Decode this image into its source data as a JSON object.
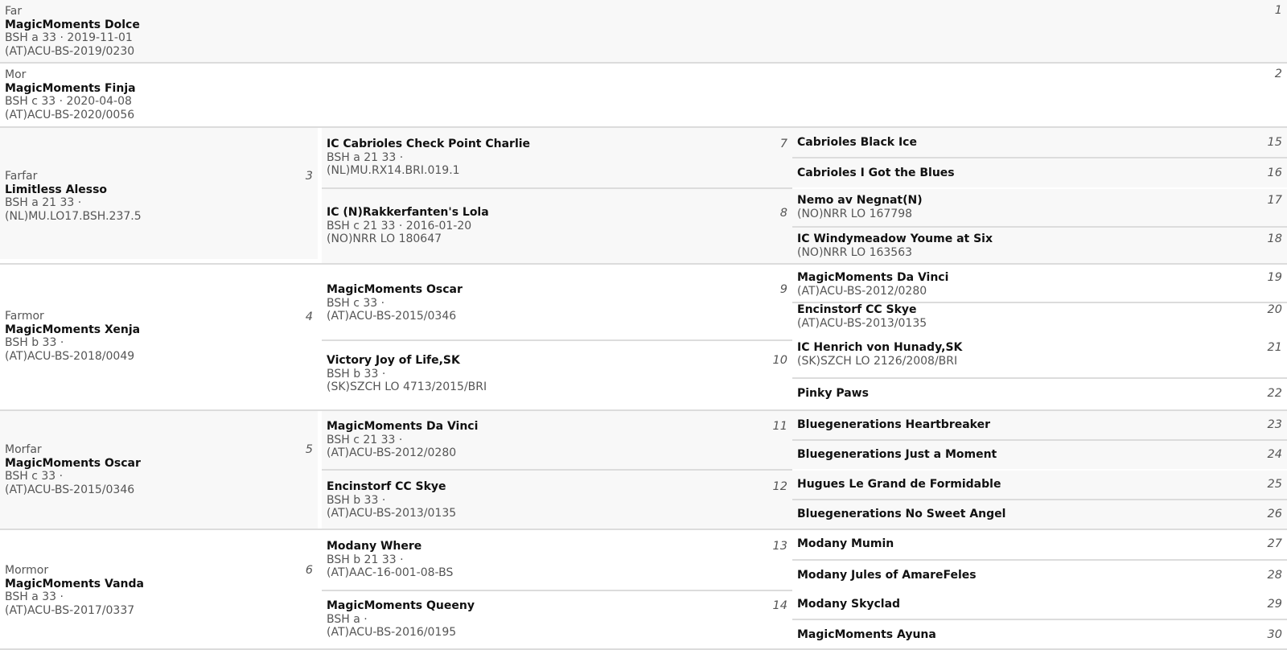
{
  "parents": [
    {
      "role": "Far",
      "name": "MagicMoments Dolce",
      "info": "BSH a 33 · 2019-11-01",
      "reg": "(AT)ACU-BS-2019/0230",
      "num": "1"
    },
    {
      "role": "Mor",
      "name": "MagicMoments Finja",
      "info": "BSH c 33 · 2020-04-08",
      "reg": "(AT)ACU-BS-2020/0056",
      "num": "2"
    }
  ],
  "grandparents": [
    {
      "role": "Farfar",
      "name": "Limitless Alesso",
      "info": "BSH a 21 33 ·",
      "reg": "(NL)MU.LO17.BSH.237.5",
      "num": "3"
    },
    {
      "role": "Farmor",
      "name": "MagicMoments Xenja",
      "info": "BSH b 33 ·",
      "reg": "(AT)ACU-BS-2018/0049",
      "num": "4"
    },
    {
      "role": "Morfar",
      "name": "MagicMoments Oscar",
      "info": "BSH c 33 ·",
      "reg": "(AT)ACU-BS-2015/0346",
      "num": "5"
    },
    {
      "role": "Mormor",
      "name": "MagicMoments Vanda",
      "info": "BSH a 33 ·",
      "reg": "(AT)ACU-BS-2017/0337",
      "num": "6"
    }
  ],
  "great_grandparents": [
    {
      "name": "IC Cabrioles Check Point Charlie",
      "info": "BSH a 21 33 ·",
      "reg": "(NL)MU.RX14.BRI.019.1",
      "num": "7"
    },
    {
      "name": "IC (N)Rakkerfanten's Lola",
      "info": "BSH c 21 33 · 2016-01-20",
      "reg": "(NO)NRR LO 180647",
      "num": "8"
    },
    {
      "name": "MagicMoments Oscar",
      "info": "BSH c 33 ·",
      "reg": "(AT)ACU-BS-2015/0346",
      "num": "9"
    },
    {
      "name": "Victory Joy of Life,SK",
      "info": "BSH b 33 ·",
      "reg": "(SK)SZCH LO 4713/2015/BRI",
      "num": "10"
    },
    {
      "name": "MagicMoments Da Vinci",
      "info": "BSH c 21 33 ·",
      "reg": "(AT)ACU-BS-2012/0280",
      "num": "11"
    },
    {
      "name": "Encinstorf CC Skye",
      "info": "BSH b 33 ·",
      "reg": "(AT)ACU-BS-2013/0135",
      "num": "12"
    },
    {
      "name": "Modany Where",
      "info": "BSH b 21 33 ·",
      "reg": "(AT)AAC-16-001-08-BS",
      "num": "13"
    },
    {
      "name": "MagicMoments Queeny",
      "info": "BSH a ·",
      "reg": "(AT)ACU-BS-2016/0195",
      "num": "14"
    }
  ],
  "great_great_grandparents": [
    {
      "name": "Cabrioles Black Ice",
      "reg": "",
      "num": "15"
    },
    {
      "name": "Cabrioles I Got the Blues",
      "reg": "",
      "num": "16"
    },
    {
      "name": "Nemo av Negnat(N)",
      "reg": "(NO)NRR LO 167798",
      "num": "17"
    },
    {
      "name": "IC Windymeadow Youme at Six",
      "reg": "(NO)NRR LO 163563",
      "num": "18"
    },
    {
      "name": "MagicMoments Da Vinci",
      "reg": "(AT)ACU-BS-2012/0280",
      "num": "19"
    },
    {
      "name": "Encinstorf CC Skye",
      "reg": "(AT)ACU-BS-2013/0135",
      "num": "20"
    },
    {
      "name": "IC Henrich von Hunady,SK",
      "reg": "(SK)SZCH LO 2126/2008/BRI",
      "num": "21"
    },
    {
      "name": "Pinky Paws",
      "reg": "",
      "num": "22"
    },
    {
      "name": "Bluegenerations Heartbreaker",
      "reg": "",
      "num": "23"
    },
    {
      "name": "Bluegenerations Just a Moment",
      "reg": "",
      "num": "24"
    },
    {
      "name": "Hugues Le Grand de Formidable",
      "reg": "",
      "num": "25"
    },
    {
      "name": "Bluegenerations No Sweet Angel",
      "reg": "",
      "num": "26"
    },
    {
      "name": "Modany Mumin",
      "reg": "",
      "num": "27"
    },
    {
      "name": "Modany Jules of AmareFeles",
      "reg": "",
      "num": "28"
    },
    {
      "name": "Modany Skyclad",
      "reg": "",
      "num": "29"
    },
    {
      "name": "MagicMoments Ayuna",
      "reg": "",
      "num": "30"
    }
  ]
}
